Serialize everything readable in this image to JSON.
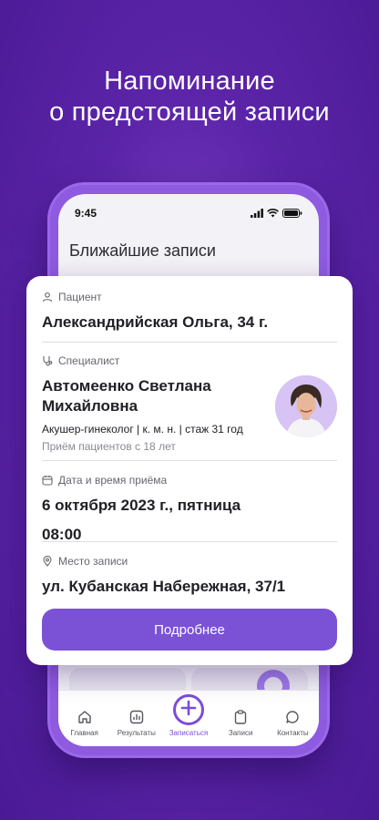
{
  "headline": {
    "line1": "Напоминание",
    "line2": "о предстоящей записи"
  },
  "phone": {
    "status_time": "9:45",
    "screen_title": "Ближайшие записи"
  },
  "card": {
    "patient_label": "Пациент",
    "patient_value": "Александрийская Ольга, 34 г.",
    "specialist_label": "Специалист",
    "specialist_name": "Автомеенко Светлана Михайловна",
    "specialist_meta": "Акушер-гинеколог | к. м. н. | стаж 31 год",
    "specialist_age": "Приём пациентов с 18 лет",
    "date_label": "Дата и время приёма",
    "date_value": "6 октября 2023 г., пятница",
    "time_value": "08:00",
    "place_label": "Место записи",
    "place_value": "ул. Кубанская Набережная, 37/1",
    "more_button": "Подробнее"
  },
  "tabs": [
    {
      "label": "Главная",
      "icon": "home-icon"
    },
    {
      "label": "Результаты",
      "icon": "results-icon"
    },
    {
      "label": "Записаться",
      "icon": "plus-icon",
      "active": true
    },
    {
      "label": "Записи",
      "icon": "clipboard-icon"
    },
    {
      "label": "Контакты",
      "icon": "chat-icon"
    }
  ],
  "colors": {
    "accent": "#7b52d6",
    "background": "#5b24a8"
  }
}
